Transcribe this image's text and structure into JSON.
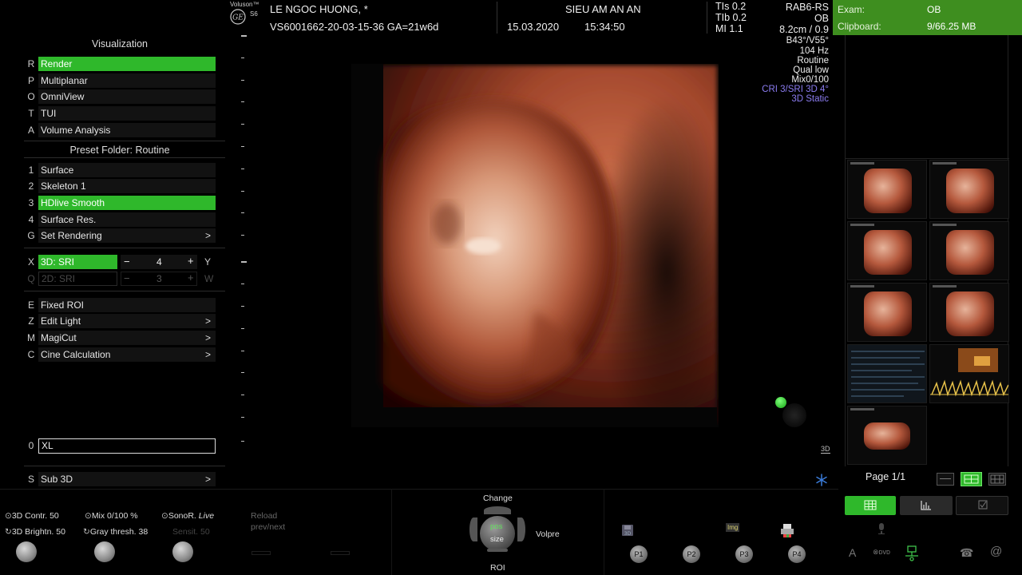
{
  "menu": {
    "title": "Visualization",
    "modes": [
      {
        "key": "R",
        "label": "Render",
        "selected": true
      },
      {
        "key": "P",
        "label": "Multiplanar",
        "selected": false
      },
      {
        "key": "O",
        "label": "OmniView",
        "selected": false
      },
      {
        "key": "T",
        "label": "TUI",
        "selected": false
      },
      {
        "key": "A",
        "label": "Volume Analysis",
        "selected": false
      }
    ],
    "preset_folder": "Preset Folder: Routine",
    "presets": [
      {
        "key": "1",
        "label": "Surface",
        "selected": false
      },
      {
        "key": "2",
        "label": "Skeleton 1",
        "selected": false
      },
      {
        "key": "3",
        "label": "HDlive Smooth",
        "selected": true
      },
      {
        "key": "4",
        "label": "Surface Res.",
        "selected": false
      },
      {
        "key": "G",
        "label": "Set Rendering",
        "selected": false,
        "arrow": ">"
      }
    ],
    "sri": {
      "key": "X",
      "label": "3D: SRI",
      "minus": "−",
      "value": "4",
      "plus": "+",
      "axis": "Y"
    },
    "sri2d": {
      "key": "Q",
      "label": "2D: SRI",
      "minus": "−",
      "value": "3",
      "plus": "+",
      "axis": "W"
    },
    "tools": [
      {
        "key": "E",
        "label": "Fixed ROI",
        "arrow": ""
      },
      {
        "key": "Z",
        "label": "Edit Light",
        "arrow": ">"
      },
      {
        "key": "M",
        "label": "MagiCut",
        "arrow": ">"
      },
      {
        "key": "C",
        "label": "Cine Calculation",
        "arrow": ">"
      }
    ],
    "xl": {
      "key": "0",
      "value": "XL"
    },
    "sub3d": {
      "key": "S",
      "label": "Sub 3D",
      "arrow": ">"
    }
  },
  "header": {
    "brand": "Voluson™",
    "model": "S6",
    "patient": "LE NGOC HUONG,    *",
    "id": "VS6001662-20-03-15-36   GA=21w6d",
    "clinic": "SIEU AM AN AN",
    "date": "15.03.2020",
    "time": "15:34:50",
    "tis": "TIs  0.2",
    "tib": "TIb  0.2",
    "mi": "MI   1.1"
  },
  "params": {
    "probe": "RAB6-RS",
    "app": "OB",
    "depth": "8.2cm / 0.9",
    "angle": "B43°/V55°",
    "freq": "104 Hz",
    "mode": "Routine",
    "qual": "Qual low",
    "mix": "Mix0/100",
    "cri": "CRI 3/SRI 3D 4°",
    "static": "3D Static"
  },
  "exam": {
    "exam_label": "Exam:",
    "exam_value": "OB",
    "clip_label": "Clipboard:",
    "clip_value": "9/66.25 MB"
  },
  "page_label": "Page 1/1",
  "badge_3d": "3D",
  "bottom": {
    "contr": "3D Contr. 50",
    "bright": "3D Brightn. 50",
    "mix": "Mix 0/100 %",
    "gray": "Gray thresh. 38",
    "sonor": "SonoR. ",
    "sonor_live": "Live",
    "sensit": "Sensit. 50",
    "reload": "Reload",
    "prevnext": "prev/next",
    "change": "Change",
    "pos": "pos",
    "size": "size",
    "roi": "ROI",
    "volpre": "Volpre",
    "p1": "P1",
    "p2": "P2",
    "p3": "P3",
    "p4": "P4",
    "img": "Img"
  },
  "colors": {
    "accent": "#2fb82b",
    "exam_bar": "#3e8e1f",
    "purple_text": "#8b7cf0"
  }
}
